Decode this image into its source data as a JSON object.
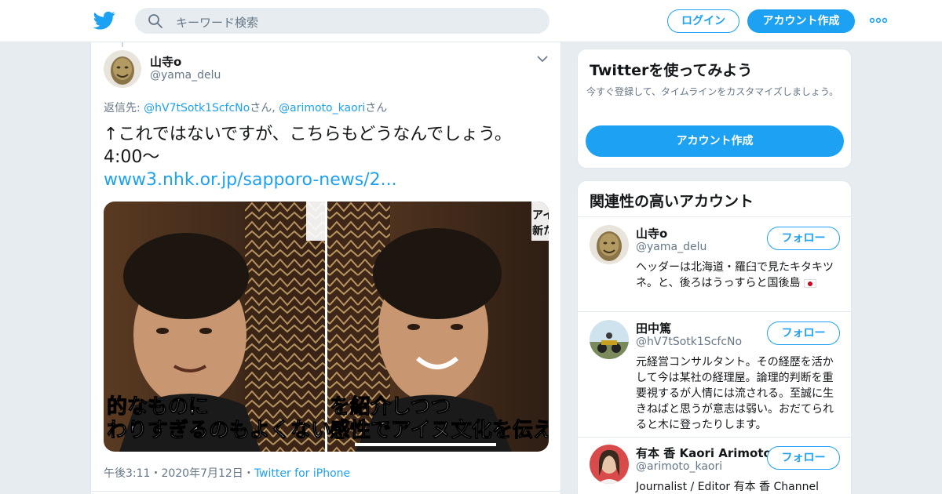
{
  "colors": {
    "accent": "#1da1f2",
    "background": "#e6ecf0",
    "secondary_text": "#657786"
  },
  "header": {
    "logo_icon": "twitter-bird-icon",
    "search_placeholder": "キーワード検索",
    "login_label": "ログイン",
    "signup_label": "アカウント作成",
    "more_icon": "more-dots-icon"
  },
  "tweet": {
    "author_name": "山寺o",
    "author_handle": "@yama_delu",
    "reply_prefix": "返信先: ",
    "reply_user1": "@hV7tSotk1ScfcNo",
    "reply_sep": "さん, ",
    "reply_user2": "@arimoto_kaori",
    "reply_suffix": "さん",
    "text_line1": "↑これではないですが、こちらもどうなんでしょう。",
    "text_line2": "4:00〜",
    "link": "www3.nhk.or.jp/sapporo-news/2...",
    "media": {
      "left_caption_1": "的なものに",
      "left_caption_2": "わりすぎるのもよくない",
      "right_caption_1": "を紹介しつつ",
      "right_caption_2": "感性でアイヌ文化を伝え",
      "corner_text_1": "アイ",
      "corner_text_2": "新た"
    },
    "time": "午後3:11",
    "date": "2020年7月12日",
    "meta_sep": "・",
    "source": "Twitter for iPhone"
  },
  "signup_card": {
    "heading": "Twitterを使ってみよう",
    "description": "今すぐ登録して、タイムラインをカスタマイズしましょう。",
    "button": "アカウント作成"
  },
  "related": {
    "heading": "関連性の高いアカウント",
    "follow_label": "フォロー",
    "accounts": [
      {
        "name": "山寺o",
        "handle": "@yama_delu",
        "bio": "ヘッダーは北海道・羅臼で見たキタキツネ。と、後ろはうっすらと国後島"
      },
      {
        "name": "田中篤",
        "handle": "@hV7tSotk1ScfcNo",
        "bio": "元経営コンサルタント。その経歴を活かして今は某社の経理屋。論理的判断を重要視するが人情には流される。至誠に生きねばと思うが意志は弱い。おだてられると木に登ったりします。"
      },
      {
        "name": "有本 香 Kaori Arimoto",
        "handle": "@arimoto_kaori",
        "bio": "Journalist / Editor 有本 香 Channel"
      }
    ]
  }
}
